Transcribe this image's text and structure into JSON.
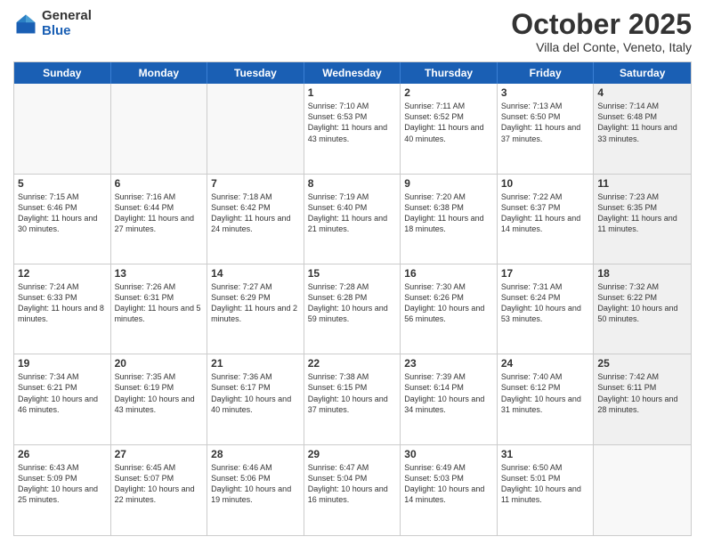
{
  "logo": {
    "general": "General",
    "blue": "Blue"
  },
  "header": {
    "month": "October 2025",
    "location": "Villa del Conte, Veneto, Italy"
  },
  "weekdays": [
    "Sunday",
    "Monday",
    "Tuesday",
    "Wednesday",
    "Thursday",
    "Friday",
    "Saturday"
  ],
  "rows": [
    [
      {
        "day": "",
        "empty": true
      },
      {
        "day": "",
        "empty": true
      },
      {
        "day": "",
        "empty": true
      },
      {
        "day": "1",
        "rise": "7:10 AM",
        "set": "6:53 PM",
        "daylight": "11 hours and 43 minutes."
      },
      {
        "day": "2",
        "rise": "7:11 AM",
        "set": "6:52 PM",
        "daylight": "11 hours and 40 minutes."
      },
      {
        "day": "3",
        "rise": "7:13 AM",
        "set": "6:50 PM",
        "daylight": "11 hours and 37 minutes."
      },
      {
        "day": "4",
        "rise": "7:14 AM",
        "set": "6:48 PM",
        "daylight": "11 hours and 33 minutes.",
        "shaded": true
      }
    ],
    [
      {
        "day": "5",
        "rise": "7:15 AM",
        "set": "6:46 PM",
        "daylight": "11 hours and 30 minutes."
      },
      {
        "day": "6",
        "rise": "7:16 AM",
        "set": "6:44 PM",
        "daylight": "11 hours and 27 minutes."
      },
      {
        "day": "7",
        "rise": "7:18 AM",
        "set": "6:42 PM",
        "daylight": "11 hours and 24 minutes."
      },
      {
        "day": "8",
        "rise": "7:19 AM",
        "set": "6:40 PM",
        "daylight": "11 hours and 21 minutes."
      },
      {
        "day": "9",
        "rise": "7:20 AM",
        "set": "6:38 PM",
        "daylight": "11 hours and 18 minutes."
      },
      {
        "day": "10",
        "rise": "7:22 AM",
        "set": "6:37 PM",
        "daylight": "11 hours and 14 minutes."
      },
      {
        "day": "11",
        "rise": "7:23 AM",
        "set": "6:35 PM",
        "daylight": "11 hours and 11 minutes.",
        "shaded": true
      }
    ],
    [
      {
        "day": "12",
        "rise": "7:24 AM",
        "set": "6:33 PM",
        "daylight": "11 hours and 8 minutes."
      },
      {
        "day": "13",
        "rise": "7:26 AM",
        "set": "6:31 PM",
        "daylight": "11 hours and 5 minutes."
      },
      {
        "day": "14",
        "rise": "7:27 AM",
        "set": "6:29 PM",
        "daylight": "11 hours and 2 minutes."
      },
      {
        "day": "15",
        "rise": "7:28 AM",
        "set": "6:28 PM",
        "daylight": "10 hours and 59 minutes."
      },
      {
        "day": "16",
        "rise": "7:30 AM",
        "set": "6:26 PM",
        "daylight": "10 hours and 56 minutes."
      },
      {
        "day": "17",
        "rise": "7:31 AM",
        "set": "6:24 PM",
        "daylight": "10 hours and 53 minutes."
      },
      {
        "day": "18",
        "rise": "7:32 AM",
        "set": "6:22 PM",
        "daylight": "10 hours and 50 minutes.",
        "shaded": true
      }
    ],
    [
      {
        "day": "19",
        "rise": "7:34 AM",
        "set": "6:21 PM",
        "daylight": "10 hours and 46 minutes."
      },
      {
        "day": "20",
        "rise": "7:35 AM",
        "set": "6:19 PM",
        "daylight": "10 hours and 43 minutes."
      },
      {
        "day": "21",
        "rise": "7:36 AM",
        "set": "6:17 PM",
        "daylight": "10 hours and 40 minutes."
      },
      {
        "day": "22",
        "rise": "7:38 AM",
        "set": "6:15 PM",
        "daylight": "10 hours and 37 minutes."
      },
      {
        "day": "23",
        "rise": "7:39 AM",
        "set": "6:14 PM",
        "daylight": "10 hours and 34 minutes."
      },
      {
        "day": "24",
        "rise": "7:40 AM",
        "set": "6:12 PM",
        "daylight": "10 hours and 31 minutes."
      },
      {
        "day": "25",
        "rise": "7:42 AM",
        "set": "6:11 PM",
        "daylight": "10 hours and 28 minutes.",
        "shaded": true
      }
    ],
    [
      {
        "day": "26",
        "rise": "6:43 AM",
        "set": "5:09 PM",
        "daylight": "10 hours and 25 minutes."
      },
      {
        "day": "27",
        "rise": "6:45 AM",
        "set": "5:07 PM",
        "daylight": "10 hours and 22 minutes."
      },
      {
        "day": "28",
        "rise": "6:46 AM",
        "set": "5:06 PM",
        "daylight": "10 hours and 19 minutes."
      },
      {
        "day": "29",
        "rise": "6:47 AM",
        "set": "5:04 PM",
        "daylight": "10 hours and 16 minutes."
      },
      {
        "day": "30",
        "rise": "6:49 AM",
        "set": "5:03 PM",
        "daylight": "10 hours and 14 minutes."
      },
      {
        "day": "31",
        "rise": "6:50 AM",
        "set": "5:01 PM",
        "daylight": "10 hours and 11 minutes."
      },
      {
        "day": "",
        "empty": true,
        "shaded": true
      }
    ]
  ]
}
